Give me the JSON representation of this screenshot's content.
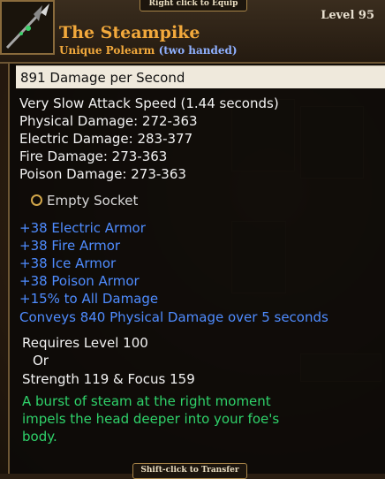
{
  "tabs": {
    "top": "Right click to Equip",
    "bottom": "Shift-click to Transfer"
  },
  "item": {
    "name": "The Steampike",
    "type": "Unique Polearm",
    "handed": "(two handed)",
    "level": "Level 95",
    "icon": "polearm-icon"
  },
  "dps": "891  Damage per Second",
  "stats": [
    "Very Slow Attack Speed (1.44 seconds)",
    "Physical Damage: 272-363",
    "Electric Damage: 283-377",
    "Fire Damage: 273-363",
    "Poison Damage: 273-363"
  ],
  "socket": "Empty Socket",
  "bonuses": [
    "+38 Electric Armor",
    "+38 Fire Armor",
    "+38 Ice Armor",
    "+38 Poison Armor",
    "+15% to All Damage",
    "Conveys 840 Physical Damage over 5 seconds"
  ],
  "requirements": {
    "level": "Requires Level 100",
    "or": "Or",
    "attributes": "Strength 119 & Focus 159"
  },
  "flavor": [
    "A burst of steam at the right moment",
    "impels the head deeper into your foe's",
    "body."
  ],
  "colors": {
    "title": "#f2a93c",
    "blue": "#4f8cff",
    "green": "#2fd26a"
  }
}
